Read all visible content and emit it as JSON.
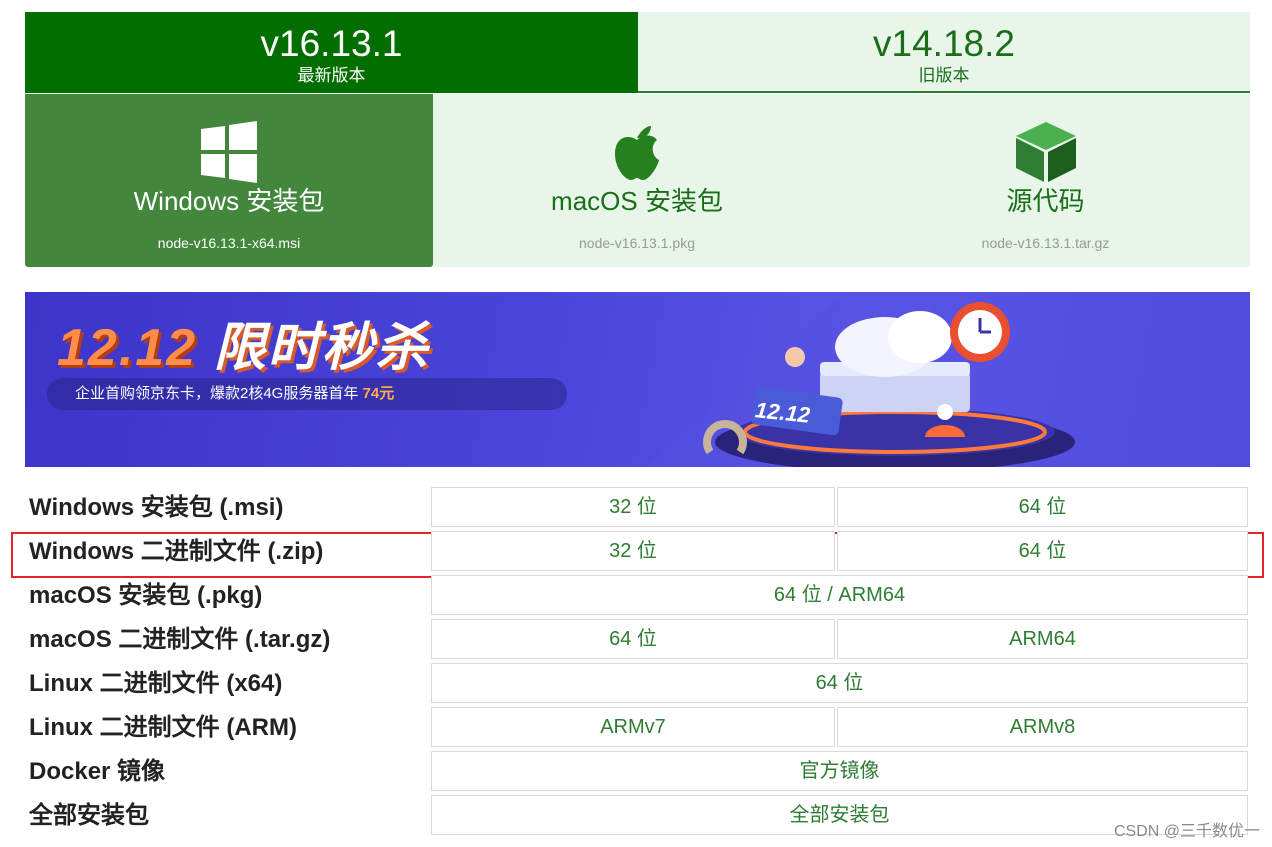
{
  "versions": {
    "current": {
      "number": "v16.13.1",
      "label": "最新版本"
    },
    "old": {
      "number": "v14.18.2",
      "label": "旧版本"
    }
  },
  "downloads": {
    "windows": {
      "title": "Windows 安装包",
      "file": "node-v16.13.1-x64.msi",
      "icon": "windows-logo-icon"
    },
    "macos": {
      "title": "macOS 安装包",
      "file": "node-v16.13.1.pkg",
      "icon": "apple-logo-icon"
    },
    "source": {
      "title": "源代码",
      "file": "node-v16.13.1.tar.gz",
      "icon": "box-icon"
    }
  },
  "banner": {
    "title_num": "12.12",
    "title_text": "限时秒杀",
    "subtitle": "企业首购领京东卡，爆款2核4G服务器首年",
    "price": "74元",
    "badge": "12.12"
  },
  "table": {
    "rows": [
      {
        "label": "Windows 安装包 (.msi)",
        "cells": [
          "32 位",
          "64 位"
        ]
      },
      {
        "label": "Windows 二进制文件 (.zip)",
        "cells": [
          "32 位",
          "64 位"
        ]
      },
      {
        "label": "macOS 安装包 (.pkg)",
        "cells": [
          "64 位 / ARM64"
        ]
      },
      {
        "label": "macOS 二进制文件 (.tar.gz)",
        "cells": [
          "64 位",
          "ARM64"
        ]
      },
      {
        "label": "Linux 二进制文件 (x64)",
        "cells": [
          "64 位"
        ]
      },
      {
        "label": "Linux 二进制文件 (ARM)",
        "cells": [
          "ARMv7",
          "ARMv8"
        ]
      },
      {
        "label": "Docker 镜像",
        "cells": [
          "官方镜像"
        ]
      },
      {
        "label": "全部安装包",
        "cells": [
          "全部安装包"
        ]
      }
    ]
  },
  "colors": {
    "brand_green": "#026e00",
    "active_box": "#43873d",
    "light_green": "#e8f5e9",
    "highlight_red": "#e0262b"
  },
  "watermark": "CSDN @三千数优一"
}
